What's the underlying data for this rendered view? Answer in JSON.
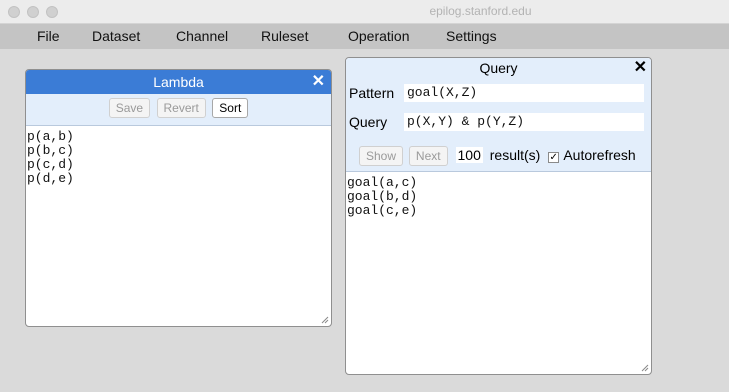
{
  "window": {
    "title": "epilog.stanford.edu"
  },
  "menu": [
    "File",
    "Dataset",
    "Channel",
    "Ruleset",
    "Operation",
    "Settings"
  ],
  "lambda": {
    "title": "Lambda",
    "buttons": {
      "save": "Save",
      "revert": "Revert",
      "sort": "Sort"
    },
    "lines": [
      "p(a,b)",
      "p(b,c)",
      "p(c,d)",
      "p(d,e)"
    ]
  },
  "query": {
    "title": "Query",
    "pattern_label": "Pattern",
    "pattern_value": "goal(X,Z)",
    "query_label": "Query",
    "query_value": "p(X,Y) & p(Y,Z)",
    "show_label": "Show",
    "next_label": "Next",
    "count": "100",
    "results_label": "result(s)",
    "autorefresh_checked": "✓",
    "autorefresh_label": "Autorefresh",
    "results": [
      "goal(a,c)",
      "goal(b,d)",
      "goal(c,e)"
    ]
  },
  "icons": {
    "close": "close-icon",
    "resize": "resize-handle-icon"
  },
  "colors": {
    "accent": "#3b7cd6",
    "toolbar": "#e3eefb"
  }
}
